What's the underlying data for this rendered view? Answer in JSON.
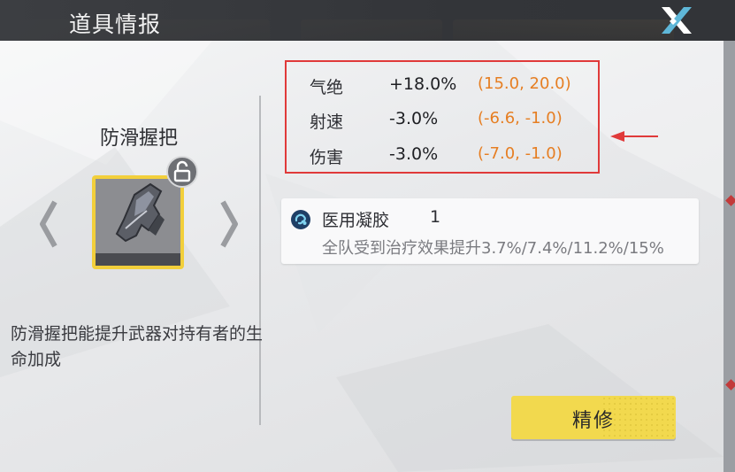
{
  "header": {
    "title": "道具情报",
    "close_icon": "close-x-icon"
  },
  "item": {
    "name": "防滑握把",
    "description": "防滑握把能提升武器对持有者的生命加成",
    "icon": "grip-icon",
    "lock_icon": "unlock-icon",
    "frame_color": "#f2cf3b"
  },
  "stats": [
    {
      "name": "气绝",
      "value": "+18.0%",
      "range": "(15.0, 20.0)"
    },
    {
      "name": "射速",
      "value": "-3.0%",
      "range": "(-6.6, -1.0)"
    },
    {
      "name": "伤害",
      "value": "-3.0%",
      "range": "(-7.0, -1.0)"
    }
  ],
  "buff": {
    "icon": "medical-gel-icon",
    "name": "医用凝胶",
    "level": "1",
    "effect": "全队受到治疗效果提升3.7%/7.4%/11.2%/15%"
  },
  "actions": {
    "refine_label": "精修"
  },
  "colors": {
    "highlight_border": "#e03a3a",
    "range_text": "#e67e22",
    "button": "#f2d94e"
  }
}
